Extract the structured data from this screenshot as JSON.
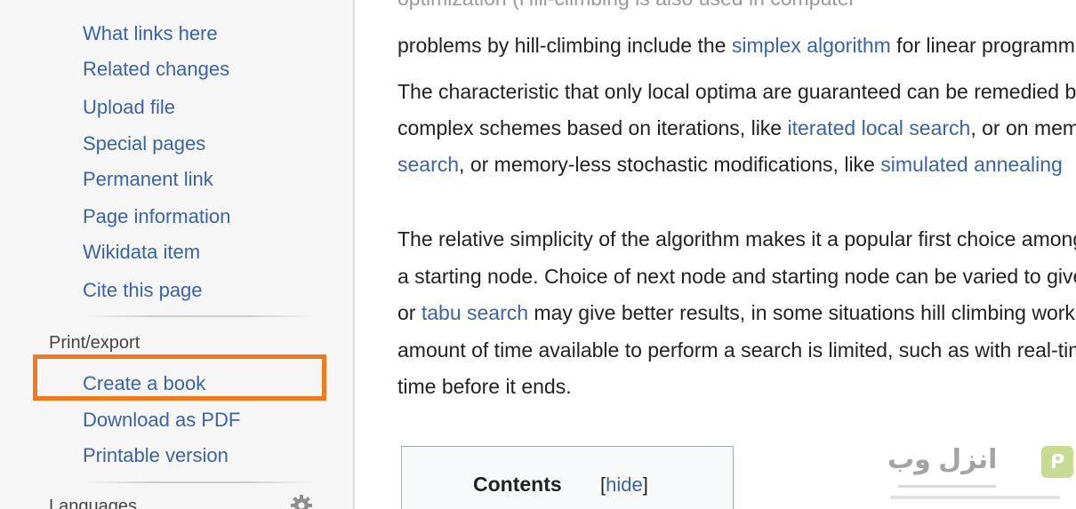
{
  "sidebar": {
    "tools": [
      "What links here",
      "Related changes",
      "Upload file",
      "Special pages",
      "Permanent link",
      "Page information",
      "Wikidata item",
      "Cite this page"
    ],
    "print_export": {
      "heading": "Print/export",
      "items": [
        "Create a book",
        "Download as PDF",
        "Printable version"
      ]
    },
    "languages_heading": "Languages"
  },
  "content": {
    "line0": "optimization (Hill-climbing is also used in computer",
    "line1": {
      "t1": "problems by hill-climbing include the ",
      "link1": "simplex algorithm",
      "t2": " for linear programming"
    },
    "line2": "The characteristic that only local optima are guaranteed can be remedied by using restarts",
    "line3": {
      "t1": "complex schemes based on iterations, like ",
      "link1": "iterated local search",
      "t2": ", or on memory, like reactive"
    },
    "line4": {
      "link1": "search",
      "t1": ", or memory-less stochastic modifications, like ",
      "link2": "simulated annealing"
    },
    "line5": "The relative simplicity of the algorithm makes it a popular first choice amongst optimizing",
    "line6": "a starting node. Choice of next node and starting node can be varied to give a list of related",
    "line7": {
      "t1": "or ",
      "link1": "tabu search",
      "t2": " may give better results, in some situations hill climbing works well"
    },
    "line8": "amount of time available to perform a search is limited, such as with real-time systems, so",
    "line9": "time before it ends.",
    "toc": {
      "title": "Contents",
      "toggle_open": "[",
      "toggle_link": "hide",
      "toggle_close": "]"
    }
  },
  "watermark": {
    "text": "انزل وب",
    "badge": "ᑭ"
  },
  "colors": {
    "link": "#3b63a7",
    "highlight": "#f07a1c",
    "sidebar_bg": "#f6f6f6"
  }
}
